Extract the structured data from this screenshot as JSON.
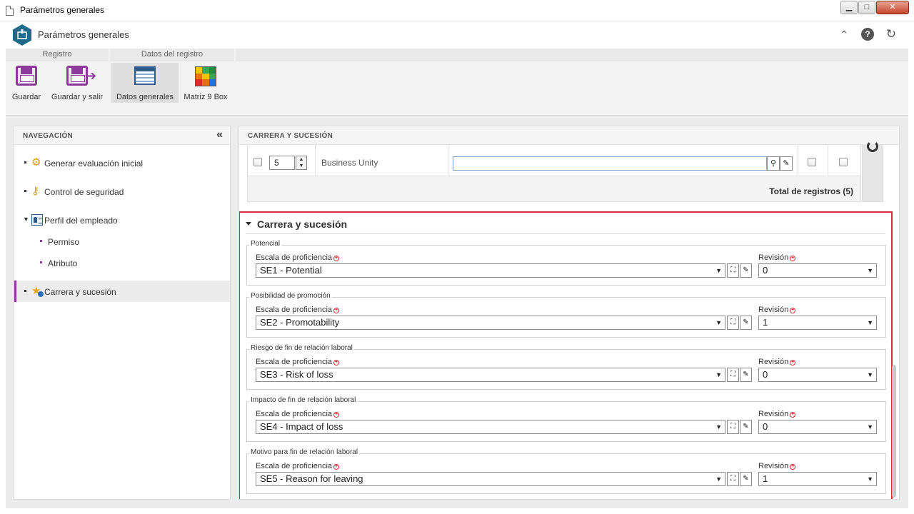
{
  "window": {
    "title": "Parámetros generales",
    "buttons": {
      "minimize": "▁",
      "maximize": "□",
      "close": "✕"
    }
  },
  "app": {
    "title": "Parámetros generales",
    "icons": [
      "collapse-up-icon",
      "help-icon",
      "refresh-icon"
    ]
  },
  "ribbon": {
    "groups": [
      "Registro",
      "Datos del registro"
    ],
    "buttons": [
      {
        "label": "Guardar",
        "icon": "save-icon"
      },
      {
        "label": "Guardar y salir",
        "icon": "save-exit-icon"
      },
      {
        "label": "Datos generales",
        "icon": "form-icon",
        "active": true
      },
      {
        "label": "Matriz 9 Box",
        "icon": "nine-box-icon"
      }
    ]
  },
  "sidebar": {
    "title": "NAVEGACIÓN",
    "items": [
      {
        "label": "Generar evaluación inicial"
      },
      {
        "label": "Control de seguridad"
      },
      {
        "label": "Perfil del empleado",
        "expanded": true
      },
      {
        "label": "Permiso"
      },
      {
        "label": "Atributo"
      },
      {
        "label": "Carrera y sucesión",
        "selected": true
      }
    ]
  },
  "main": {
    "title": "CARRERA Y SUCESIÓN",
    "grid": {
      "row": {
        "number": "5",
        "label": "Business Unity",
        "input_value": ""
      },
      "total": "Total de registros (5)"
    },
    "section": {
      "title": "Carrera y sucesión",
      "scale_label": "Escala de proficiencia",
      "revision_label": "Revisión",
      "fieldsets": [
        {
          "legend": "Potencial",
          "scale": "SE1 - Potential",
          "revision": "0"
        },
        {
          "legend": "Posibilidad de promoción",
          "scale": "SE2 - Promotability",
          "revision": "1"
        },
        {
          "legend": "Riesgo de fin de relación laboral",
          "scale": "SE3 - Risk of loss",
          "revision": "0"
        },
        {
          "legend": "Impacto de fin de relación laboral",
          "scale": "SE4 - Impact of loss",
          "revision": "0"
        },
        {
          "legend": "Motivo para fin de relación laboral",
          "scale": "SE5 - Reason for leaving",
          "revision": "1"
        }
      ]
    }
  },
  "colors": {
    "accent": "#8e3a9c",
    "highlight": "#d62e35",
    "brand": "#1d6a8a"
  }
}
